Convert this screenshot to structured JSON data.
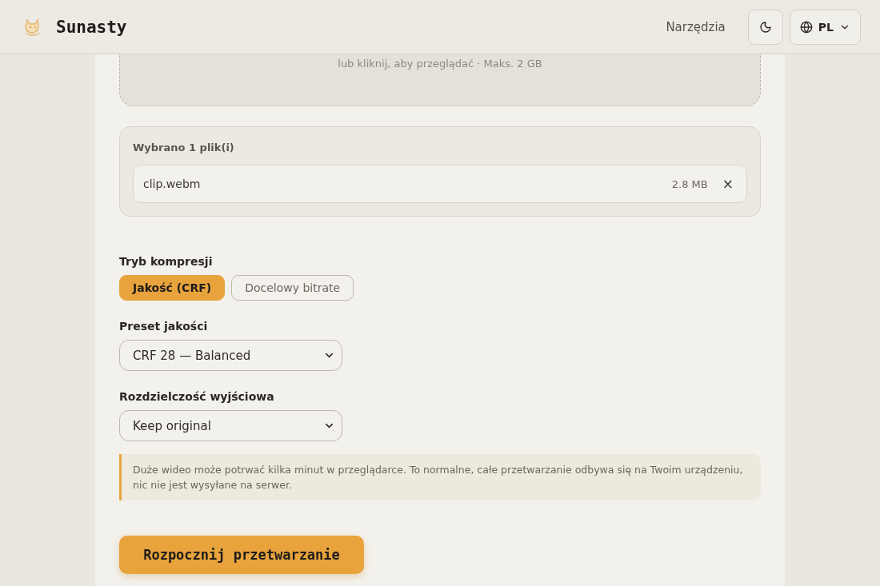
{
  "header": {
    "brand": "Sunasty",
    "nav_link": "Narzędzia",
    "language": "PL"
  },
  "drop_zone": {
    "hint": "lub kliknij, aby przeglądać · Maks. 2 GB"
  },
  "selection": {
    "title": "Wybrano 1 plik(i)",
    "files": [
      {
        "name": "clip.webm",
        "size": "2.8 MB",
        "remove": "×"
      }
    ]
  },
  "compression_mode": {
    "label": "Tryb kompresji",
    "options": [
      {
        "label": "Jakość (CRF)",
        "selected": true
      },
      {
        "label": "Docelowy bitrate",
        "selected": false
      }
    ]
  },
  "quality_preset": {
    "label": "Preset jakości",
    "value": "CRF 28 — Balanced"
  },
  "output_resolution": {
    "label": "Rozdzielczość wyjściowa",
    "value": "Keep original"
  },
  "notice": "Duże wideo może potrwać kilka minut w przeglądarce. To normalne, całe przetwarzanie odbywa się na Twoim urządzeniu, nic nie jest wysyłane na serwer.",
  "start_button": "Rozpocznij przetwarzanie"
}
